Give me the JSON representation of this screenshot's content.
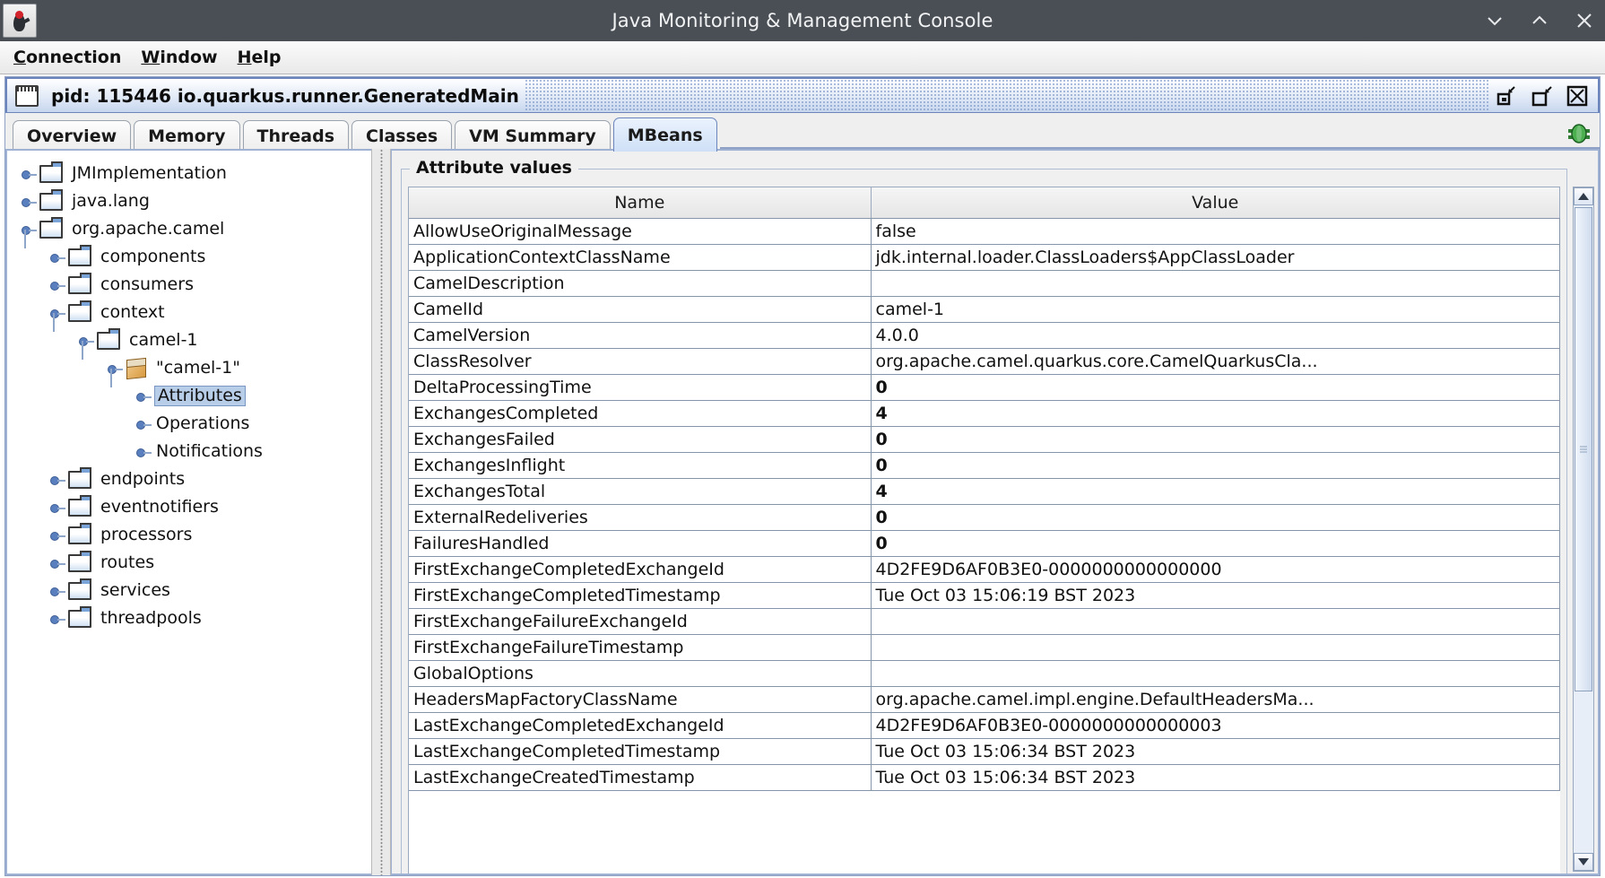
{
  "window": {
    "title": "Java Monitoring & Management Console",
    "logo_icon": "java-duke-icon",
    "controls": [
      {
        "name": "minimize-button",
        "glyph": "chevron-down-icon"
      },
      {
        "name": "maximize-button",
        "glyph": "chevron-up-icon"
      },
      {
        "name": "close-button",
        "glyph": "close-icon"
      }
    ]
  },
  "menubar": {
    "items": [
      {
        "mnemonic": "C",
        "rest": "onnection"
      },
      {
        "mnemonic": "W",
        "rest": "indow"
      },
      {
        "mnemonic": "H",
        "rest": "elp"
      }
    ]
  },
  "internal_frame": {
    "title": "pid: 115446 io.quarkus.runner.GeneratedMain",
    "buttons": [
      {
        "name": "iframe-minimize-button",
        "glyph": "restore-small-icon"
      },
      {
        "name": "iframe-maximize-button",
        "glyph": "restore-large-icon"
      },
      {
        "name": "iframe-close-button",
        "glyph": "close-box-icon"
      }
    ]
  },
  "tabs": {
    "items": [
      "Overview",
      "Memory",
      "Threads",
      "Classes",
      "VM Summary",
      "MBeans"
    ],
    "selected": "MBeans",
    "corner_icon": "plug-connected-icon"
  },
  "tree": {
    "nodes": [
      {
        "label": "JMImplementation",
        "depth": 0,
        "icon": "folder-icon",
        "expandable": true,
        "expanded": false,
        "selected": false
      },
      {
        "label": "java.lang",
        "depth": 0,
        "icon": "folder-icon",
        "expandable": true,
        "expanded": false,
        "selected": false
      },
      {
        "label": "org.apache.camel",
        "depth": 0,
        "icon": "folder-icon",
        "expandable": true,
        "expanded": true,
        "selected": false
      },
      {
        "label": "components",
        "depth": 1,
        "icon": "folder-icon",
        "expandable": true,
        "expanded": false,
        "selected": false
      },
      {
        "label": "consumers",
        "depth": 1,
        "icon": "folder-icon",
        "expandable": true,
        "expanded": false,
        "selected": false
      },
      {
        "label": "context",
        "depth": 1,
        "icon": "folder-icon",
        "expandable": true,
        "expanded": true,
        "selected": false
      },
      {
        "label": "camel-1",
        "depth": 2,
        "icon": "folder-icon",
        "expandable": true,
        "expanded": true,
        "selected": false
      },
      {
        "label": "\"camel-1\"",
        "depth": 3,
        "icon": "mbean-icon",
        "expandable": true,
        "expanded": true,
        "selected": false
      },
      {
        "label": "Attributes",
        "depth": 4,
        "icon": "none",
        "expandable": true,
        "expanded": false,
        "selected": true
      },
      {
        "label": "Operations",
        "depth": 4,
        "icon": "none",
        "expandable": true,
        "expanded": false,
        "selected": false
      },
      {
        "label": "Notifications",
        "depth": 4,
        "icon": "none",
        "expandable": true,
        "expanded": false,
        "selected": false
      },
      {
        "label": "endpoints",
        "depth": 1,
        "icon": "folder-icon",
        "expandable": true,
        "expanded": false,
        "selected": false
      },
      {
        "label": "eventnotifiers",
        "depth": 1,
        "icon": "folder-icon",
        "expandable": true,
        "expanded": false,
        "selected": false
      },
      {
        "label": "processors",
        "depth": 1,
        "icon": "folder-icon",
        "expandable": true,
        "expanded": false,
        "selected": false
      },
      {
        "label": "routes",
        "depth": 1,
        "icon": "folder-icon",
        "expandable": true,
        "expanded": false,
        "selected": false
      },
      {
        "label": "services",
        "depth": 1,
        "icon": "folder-icon",
        "expandable": true,
        "expanded": false,
        "selected": false
      },
      {
        "label": "threadpools",
        "depth": 1,
        "icon": "folder-icon",
        "expandable": true,
        "expanded": false,
        "selected": false
      }
    ]
  },
  "attribute_panel": {
    "group_title": "Attribute values",
    "columns": [
      "Name",
      "Value"
    ],
    "rows": [
      {
        "name": "AllowUseOriginalMessage",
        "value": "false",
        "numeric": false
      },
      {
        "name": "ApplicationContextClassName",
        "value": "jdk.internal.loader.ClassLoaders$AppClassLoader",
        "numeric": false
      },
      {
        "name": "CamelDescription",
        "value": "",
        "numeric": false
      },
      {
        "name": "CamelId",
        "value": "camel-1",
        "numeric": false
      },
      {
        "name": "CamelVersion",
        "value": "4.0.0",
        "numeric": false
      },
      {
        "name": "ClassResolver",
        "value": "org.apache.camel.quarkus.core.CamelQuarkusCla...",
        "numeric": false
      },
      {
        "name": "DeltaProcessingTime",
        "value": "0",
        "numeric": true
      },
      {
        "name": "ExchangesCompleted",
        "value": "4",
        "numeric": true
      },
      {
        "name": "ExchangesFailed",
        "value": "0",
        "numeric": true
      },
      {
        "name": "ExchangesInflight",
        "value": "0",
        "numeric": true
      },
      {
        "name": "ExchangesTotal",
        "value": "4",
        "numeric": true
      },
      {
        "name": "ExternalRedeliveries",
        "value": "0",
        "numeric": true
      },
      {
        "name": "FailuresHandled",
        "value": "0",
        "numeric": true
      },
      {
        "name": "FirstExchangeCompletedExchangeId",
        "value": "4D2FE9D6AF0B3E0-0000000000000000",
        "numeric": false
      },
      {
        "name": "FirstExchangeCompletedTimestamp",
        "value": "Tue Oct 03 15:06:19 BST 2023",
        "numeric": false
      },
      {
        "name": "FirstExchangeFailureExchangeId",
        "value": "",
        "numeric": false
      },
      {
        "name": "FirstExchangeFailureTimestamp",
        "value": "",
        "numeric": false
      },
      {
        "name": "GlobalOptions",
        "value": "",
        "numeric": false
      },
      {
        "name": "HeadersMapFactoryClassName",
        "value": "org.apache.camel.impl.engine.DefaultHeadersMa...",
        "numeric": false
      },
      {
        "name": "LastExchangeCompletedExchangeId",
        "value": "4D2FE9D6AF0B3E0-0000000000000003",
        "numeric": false
      },
      {
        "name": "LastExchangeCompletedTimestamp",
        "value": "Tue Oct 03 15:06:34 BST 2023",
        "numeric": false
      },
      {
        "name": "LastExchangeCreatedTimestamp",
        "value": "Tue Oct 03 15:06:34 BST 2023",
        "numeric": false
      }
    ]
  },
  "scrollbar": {
    "up_icon": "scroll-up-arrow-icon",
    "down_icon": "scroll-down-arrow-icon",
    "thumb_name": "scroll-thumb"
  }
}
